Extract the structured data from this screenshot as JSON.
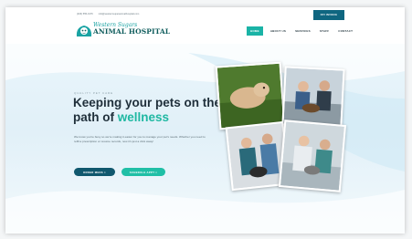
{
  "topbar": {
    "phone": "(406) 555-0176",
    "email": "info@westernsuperanimalhospital.com",
    "pay_button": "PAY INVOICE"
  },
  "logo": {
    "line1": "Western Sugars",
    "line2": "ANIMAL HOSPITAL"
  },
  "nav": {
    "items": [
      "HOME",
      "ABOUT US",
      "SERVICES",
      "STAFF",
      "CONTACT"
    ],
    "active": "HOME"
  },
  "hero": {
    "eyebrow": "QUALITY PET CARE",
    "title_part1": "Keeping your pets on the path of ",
    "title_accent": "wellness",
    "body": "We know you're busy so we're making it easier for you to manage your pet's needs. Whether you need to refill a prescription or resume records, now it's just a click away!",
    "btn_order": "ORDER MEDS >",
    "btn_appt": "SCHEDULE APPT >"
  },
  "photos": [
    {
      "name": "dog-on-grass-photo"
    },
    {
      "name": "staff-with-pet-photo"
    },
    {
      "name": "vet-exam-photo"
    },
    {
      "name": "cat-exam-photo"
    }
  ],
  "colors": {
    "teal": "#1ab3a6",
    "navy": "#10586e",
    "accent": "#1fb8a2"
  }
}
